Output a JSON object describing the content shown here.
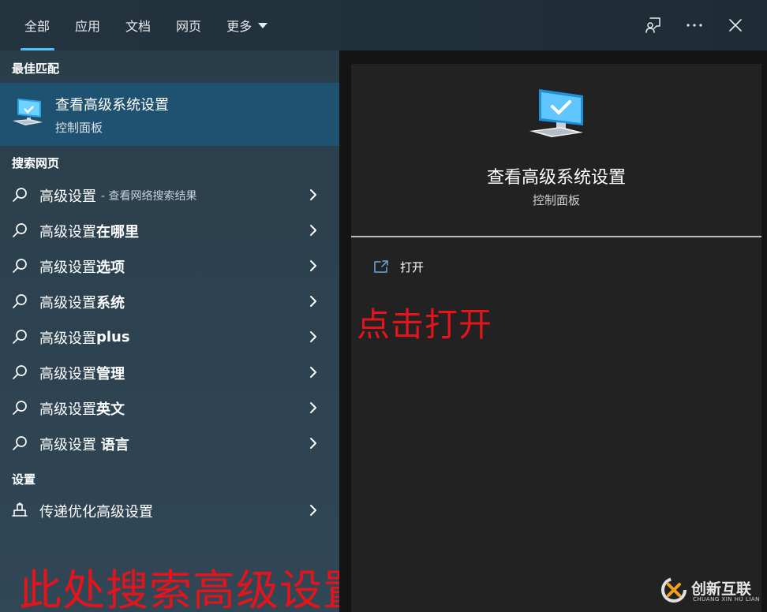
{
  "tabs": [
    {
      "label": "全部",
      "active": true
    },
    {
      "label": "应用",
      "active": false
    },
    {
      "label": "文档",
      "active": false
    },
    {
      "label": "网页",
      "active": false
    },
    {
      "label": "更多",
      "active": false
    }
  ],
  "top_actions": {
    "feedback_icon": "feedback-person-icon",
    "more_icon": "ellipsis-icon",
    "close_icon": "close-icon"
  },
  "left": {
    "best_match_heading": "最佳匹配",
    "best_match": {
      "title": "查看高级系统设置",
      "subtitle": "控制面板",
      "icon": "control-panel-computer-icon"
    },
    "web_heading": "搜索网页",
    "web_results": [
      {
        "normal": "高级设置",
        "bold": "",
        "hint": "- 查看网络搜索结果"
      },
      {
        "normal": "高级设置",
        "bold": "在哪里",
        "hint": ""
      },
      {
        "normal": "高级设置",
        "bold": "选项",
        "hint": ""
      },
      {
        "normal": "高级设置",
        "bold": "系统",
        "hint": ""
      },
      {
        "normal": "高级设置",
        "bold": "plus",
        "hint": ""
      },
      {
        "normal": "高级设置",
        "bold": "管理",
        "hint": ""
      },
      {
        "normal": "高级设置",
        "bold": "英文",
        "hint": ""
      },
      {
        "normal": "高级设置 ",
        "bold": "语言",
        "hint": ""
      }
    ],
    "settings_heading": "设置",
    "settings_results": [
      {
        "label": "传递优化高级设置",
        "icon": "delivery-optimization-icon"
      }
    ],
    "annotation": "此处搜索高级设置"
  },
  "right": {
    "title": "查看高级系统设置",
    "subtitle": "控制面板",
    "open_label": "打开",
    "annotation": "点击打开"
  },
  "watermark": {
    "text": "创新互联",
    "sub": "CHUANG XIN HU LIAN"
  },
  "colors": {
    "accent": "#4cc2ff",
    "selected_bg": "#1f5271",
    "annotation_red": "#e3141b"
  }
}
